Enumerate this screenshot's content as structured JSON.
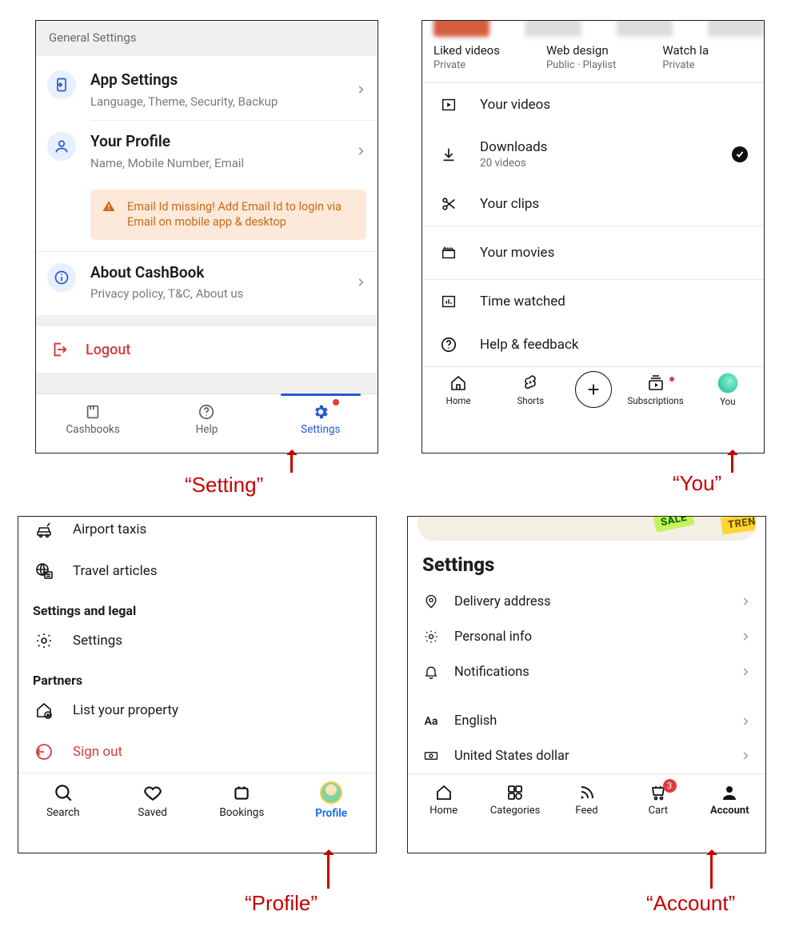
{
  "a": {
    "header": "General Settings",
    "items": [
      {
        "title": "App Settings",
        "sub": "Language, Theme, Security, Backup"
      },
      {
        "title": "Your Profile",
        "sub": "Name, Mobile Number, Email"
      }
    ],
    "warning": "Email Id missing! Add Email Id to login via Email on mobile app & desktop",
    "about": {
      "title": "About CashBook",
      "sub": "Privacy policy, T&C, About us"
    },
    "logout": "Logout",
    "tabs": [
      "Cashbooks",
      "Help",
      "Settings"
    ]
  },
  "b": {
    "playlists": [
      {
        "title": "Liked videos",
        "sub": "Private"
      },
      {
        "title": "Web design",
        "sub": "Public · Playlist"
      },
      {
        "title": "Watch la",
        "sub": "Private"
      }
    ],
    "rows": {
      "your_videos": "Your videos",
      "downloads": {
        "title": "Downloads",
        "sub": "20 videos"
      },
      "your_clips": "Your clips",
      "your_movies": "Your movies",
      "time_watched": "Time watched",
      "help": "Help & feedback"
    },
    "tabs": [
      "Home",
      "Shorts",
      "Subscriptions",
      "You"
    ]
  },
  "c": {
    "quick": [
      "Airport taxis",
      "Travel articles"
    ],
    "section_settings": "Settings and legal",
    "settings_item": "Settings",
    "section_partners": "Partners",
    "partners_item": "List your property",
    "signout": "Sign out",
    "tabs": [
      "Search",
      "Saved",
      "Bookings",
      "Profile"
    ]
  },
  "d": {
    "sale": "SALE",
    "trend": "TREN",
    "heading": "Settings",
    "rows": {
      "delivery": "Delivery address",
      "personal": "Personal info",
      "notifications": "Notifications",
      "language": "English",
      "currency": "United States dollar"
    },
    "tabs": [
      "Home",
      "Categories",
      "Feed",
      "Cart",
      "Account"
    ],
    "cart_count": "3"
  },
  "annotations": {
    "a": "“Setting”",
    "b": "“You”",
    "c": "“Profile”",
    "d": "“Account”"
  }
}
